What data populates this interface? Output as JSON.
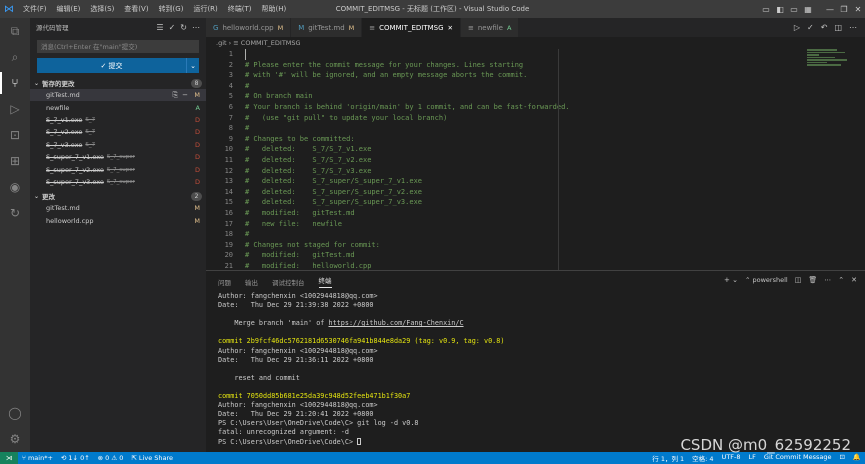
{
  "titlebar": {
    "logo": "⋈",
    "menu": [
      "文件(F)",
      "编辑(E)",
      "选择(S)",
      "查看(V)",
      "转到(G)",
      "运行(R)",
      "终端(T)",
      "帮助(H)"
    ],
    "title": "COMMIT_EDITMSG - 无标题 (工作区) - Visual Studio Code",
    "controls": [
      "▭",
      "◧",
      "▭",
      "▦",
      "—",
      "❐",
      "✕"
    ]
  },
  "activity": {
    "items": [
      "⧉",
      "⌕",
      "⑂",
      "▷",
      "⊡",
      "⊞",
      "◉",
      "↻"
    ],
    "bottom": [
      "◯",
      "⚙"
    ]
  },
  "sidebar": {
    "title": "源代码管理",
    "tools": [
      "☰",
      "✓",
      "↻",
      "⋯"
    ],
    "message_placeholder": "消息(Ctrl+Enter 在\"main\"提交)",
    "commit_label": "✓ 提交",
    "commit_drop": "⌄",
    "staged": {
      "title": "暂存的更改",
      "count": "8",
      "files": [
        {
          "name": "gitTest.md",
          "dir": "",
          "status": "M",
          "deleted": false,
          "selected": true
        },
        {
          "name": "newfile",
          "dir": "",
          "status": "A",
          "deleted": false,
          "selected": false
        },
        {
          "name": "S_7_v1.exe",
          "dir": "S_7",
          "status": "D",
          "deleted": true,
          "selected": false
        },
        {
          "name": "S_7_v2.exe",
          "dir": "S_7",
          "status": "D",
          "deleted": true,
          "selected": false
        },
        {
          "name": "S_7_v3.exe",
          "dir": "S_7",
          "status": "D",
          "deleted": true,
          "selected": false
        },
        {
          "name": "S_super_7_v1.exe",
          "dir": "S_7_super",
          "status": "D",
          "deleted": true,
          "selected": false
        },
        {
          "name": "S_super_7_v2.exe",
          "dir": "S_7_super",
          "status": "D",
          "deleted": true,
          "selected": false
        },
        {
          "name": "S_super_7_v3.exe",
          "dir": "S_7_super",
          "status": "D",
          "deleted": true,
          "selected": false
        }
      ]
    },
    "changes": {
      "title": "更改",
      "count": "2",
      "files": [
        {
          "name": "gitTest.md",
          "dir": "",
          "status": "M",
          "deleted": false,
          "selected": false
        },
        {
          "name": "helloworld.cpp",
          "dir": "",
          "status": "M",
          "deleted": false,
          "selected": false
        }
      ]
    },
    "row_actions": [
      "⎘",
      "−",
      "M"
    ]
  },
  "tabs": {
    "items": [
      {
        "label": "helloworld.cpp",
        "mod": "M",
        "icon": "G",
        "active": false
      },
      {
        "label": "gitTest.md",
        "mod": "M",
        "icon": "M",
        "active": false
      },
      {
        "label": "COMMIT_EDITMSG",
        "mod": "✕",
        "icon": "≡",
        "active": true
      },
      {
        "label": "newfile",
        "mod": "A",
        "icon": "≡",
        "active": false
      }
    ],
    "actions": [
      "▷",
      "✓",
      "↶",
      "◫",
      "⋯"
    ]
  },
  "breadcrumb": ".git  ›  ≡ COMMIT_EDITMSG",
  "editor": {
    "lines": [
      "",
      "# Please enter the commit message for your changes. Lines starting",
      "# with '#' will be ignored, and an empty message aborts the commit.",
      "#",
      "# On branch main",
      "# Your branch is behind 'origin/main' by 1 commit, and can be fast-forwarded.",
      "#   (use \"git pull\" to update your local branch)",
      "#",
      "# Changes to be committed:",
      "#   deleted:    S_7/S_7_v1.exe",
      "#   deleted:    S_7/S_7_v2.exe",
      "#   deleted:    S_7/S_7_v3.exe",
      "#   deleted:    S_7_super/S_super_7_v1.exe",
      "#   deleted:    S_7_super/S_super_7_v2.exe",
      "#   deleted:    S_7_super/S_super_7_v3.exe",
      "#   modified:   gitTest.md",
      "#   new file:   newfile",
      "#",
      "# Changes not staged for commit:",
      "#   modified:   gitTest.md",
      "#   modified:   helloworld.cpp"
    ]
  },
  "panel": {
    "tabs": [
      "问题",
      "输出",
      "调试控制台",
      "终端"
    ],
    "active_tab": 3,
    "actions": {
      "add": "+ ⌄",
      "shell": "⌃ powershell",
      "split": "◫",
      "trash": "🗑",
      "more": "⋯",
      "max": "⌃",
      "close": "✕"
    },
    "terminal": [
      {
        "t": "Author: fangchenxin <1002944818@qq.com>",
        "c": ""
      },
      {
        "t": "Date:   Thu Dec 29 21:39:38 2022 +0800",
        "c": ""
      },
      {
        "t": "",
        "c": ""
      },
      {
        "t": "    Merge branch 'main' of ",
        "c": "",
        "link": "https://github.com/Fang-Chenxin/C"
      },
      {
        "t": "",
        "c": ""
      },
      {
        "t": "commit 2b9fcf46dc5762181d6530746fa941b844e8da29 (tag: v0.9, tag: v0.8)",
        "c": "t-yellow"
      },
      {
        "t": "Author: fangchenxin <1002944818@qq.com>",
        "c": ""
      },
      {
        "t": "Date:   Thu Dec 29 21:36:11 2022 +0800",
        "c": ""
      },
      {
        "t": "",
        "c": ""
      },
      {
        "t": "    reset and commit",
        "c": ""
      },
      {
        "t": "",
        "c": ""
      },
      {
        "t": "commit 7050dd85b681e25da39c948d52feeb471b1f30a7",
        "c": "t-yellow"
      },
      {
        "t": "Author: fangchenxin <1002944818@qq.com>",
        "c": ""
      },
      {
        "t": "Date:   Thu Dec 29 21:20:41 2022 +0800",
        "c": ""
      },
      {
        "t": "PS C:\\Users\\User\\OneDrive\\Code\\C> git log -d v0.8",
        "c": ""
      },
      {
        "t": "fatal: unrecognized argument: -d",
        "c": ""
      },
      {
        "t": "PS C:\\Users\\User\\OneDrive\\Code\\C> ",
        "c": "",
        "cursor": true
      }
    ]
  },
  "statusbar": {
    "remote": "⋊",
    "branch": "⑂ main*+",
    "sync": "⟲ 1↓ 0↑",
    "problems": "⊗ 0 ⚠ 0",
    "liveshare": "⇱ Live Share",
    "right": [
      "行 1，列 1",
      "空格: 4",
      "UTF-8",
      "LF",
      "Git Commit Message",
      "⊡",
      "🔔"
    ]
  },
  "watermark": "CSDN @m0_62592252"
}
